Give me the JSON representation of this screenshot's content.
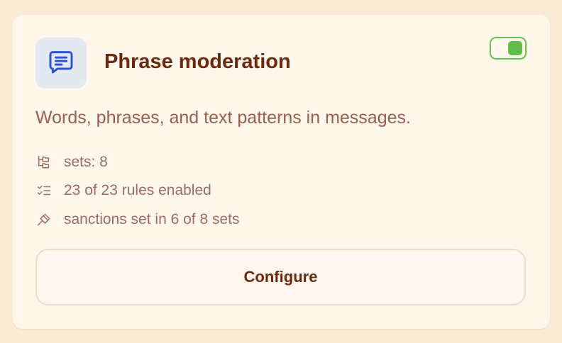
{
  "card": {
    "title": "Phrase moderation",
    "description": "Words, phrases, and text patterns in messages.",
    "icon": "message-text-icon",
    "enabled": true,
    "stats": [
      {
        "icon": "folder-tree-icon",
        "text": "sets: 8"
      },
      {
        "icon": "checklist-icon",
        "text": "23 of 23 rules enabled"
      },
      {
        "icon": "gavel-icon",
        "text": "sanctions set in 6 of 8 sets"
      }
    ],
    "configure_label": "Configure"
  },
  "colors": {
    "page_background": "#faebd7",
    "card_background": "#fff6ec",
    "title": "#6b2a10",
    "description": "#98604a",
    "icon_tile": "#e4e8f1",
    "icon_blue": "#2f52d6",
    "toggle_on": "#63bd4b"
  }
}
